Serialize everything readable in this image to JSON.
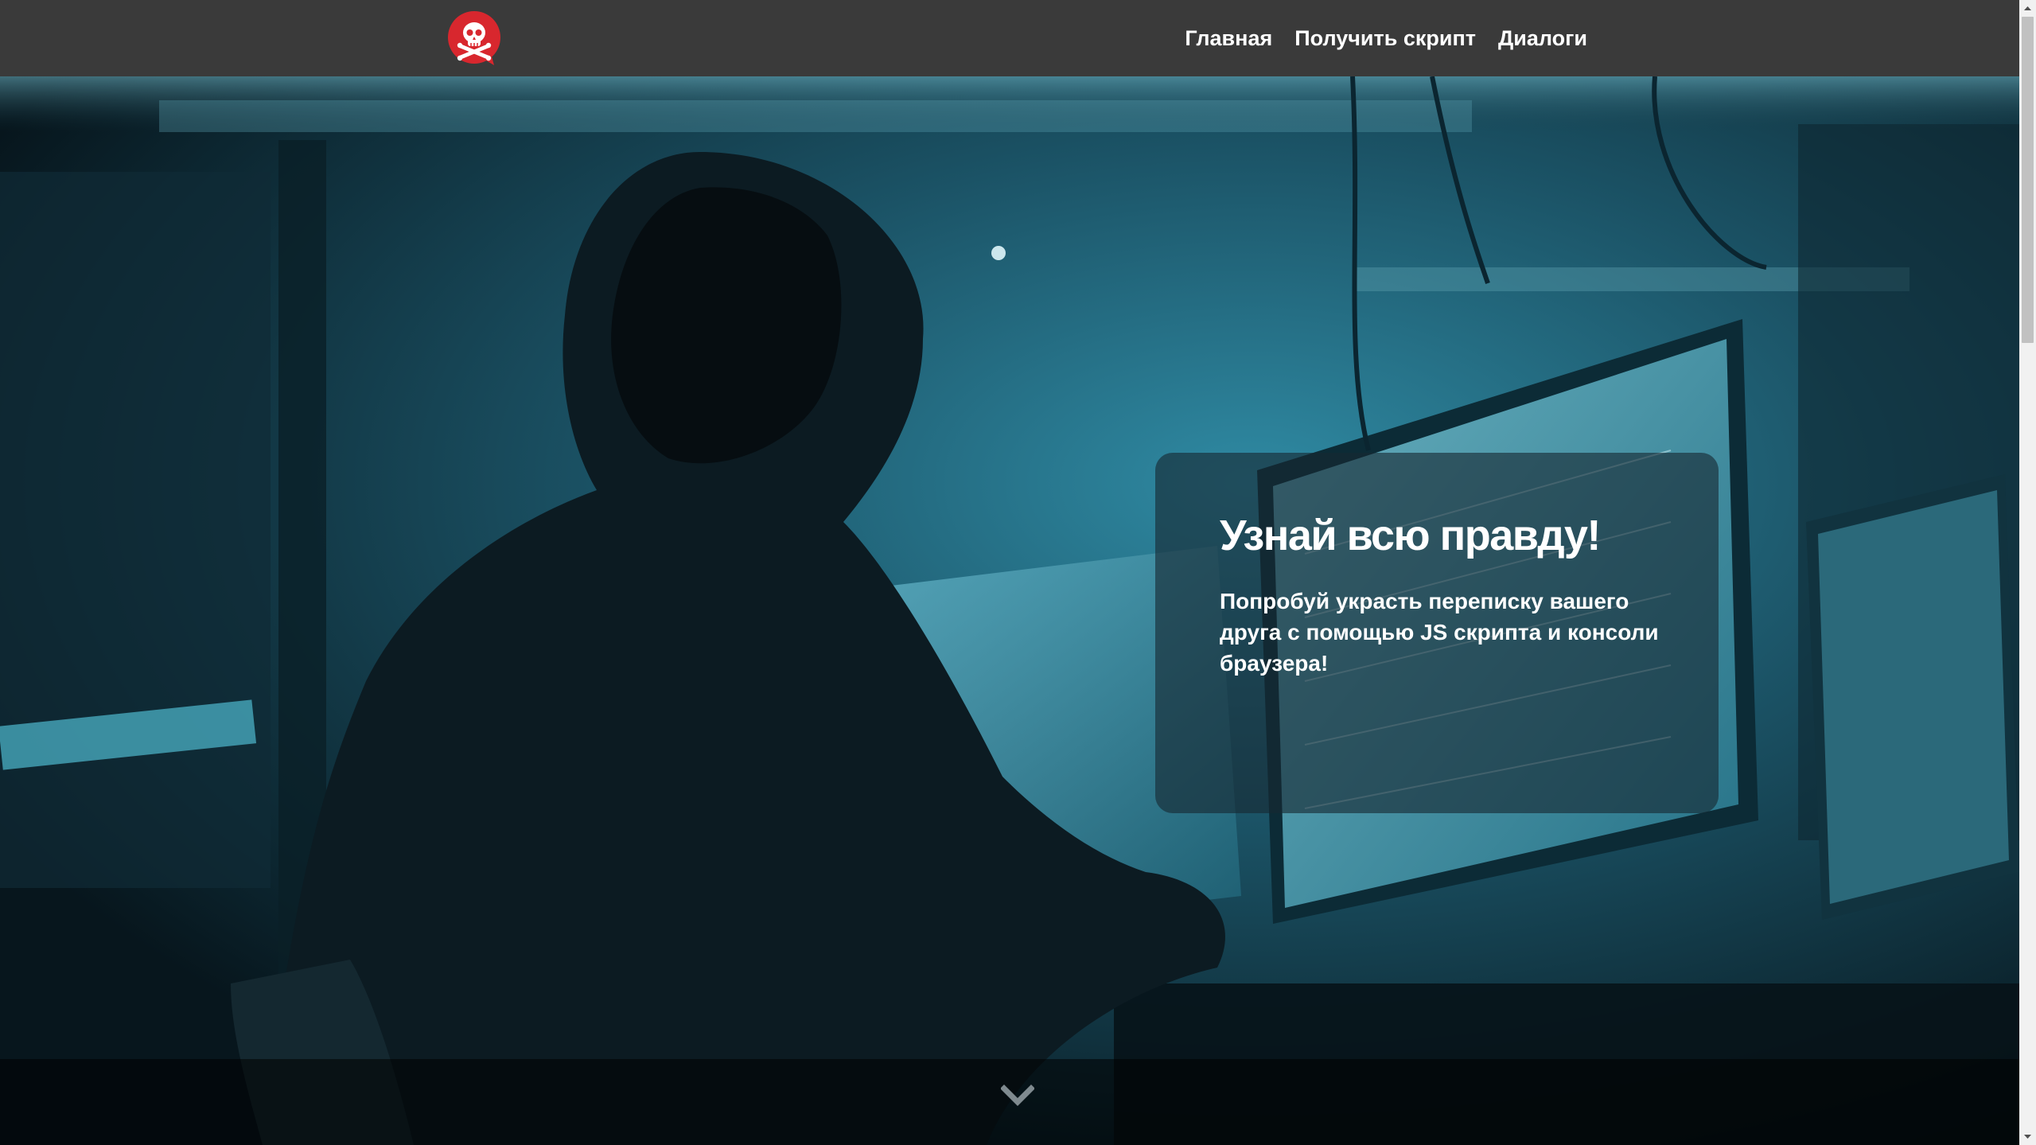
{
  "header": {
    "logo": "skull-crossbones-logo",
    "nav": [
      {
        "label": "Главная"
      },
      {
        "label": "Получить скрипт"
      },
      {
        "label": "Диалоги"
      }
    ]
  },
  "hero": {
    "background": "hooded hacker at computer monitors",
    "title": "Узнай всю правду!",
    "text": "Попробуй украсть переписку вашего друга с помощью JS скрипта и консоли браузера!",
    "scroll_icon": "chevron-down-icon"
  },
  "colors": {
    "navbar": "#3a3a3a",
    "logo_red": "#d8272e",
    "card_bg": "rgba(22,40,50,0.62)",
    "hero_tint": "#2b7b92"
  }
}
